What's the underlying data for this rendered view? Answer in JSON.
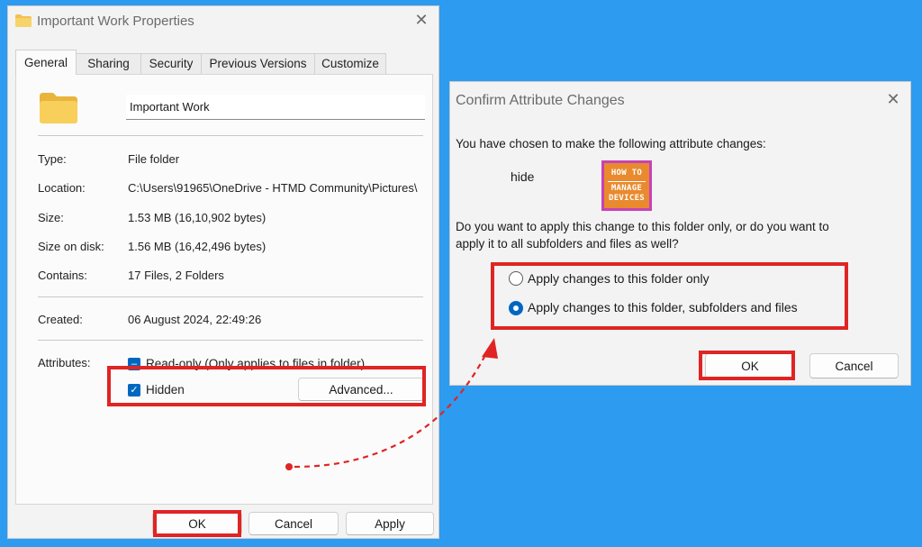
{
  "properties": {
    "title": "Important Work Properties",
    "close_glyph": "✕",
    "tabs": [
      {
        "label": "General"
      },
      {
        "label": "Sharing"
      },
      {
        "label": "Security"
      },
      {
        "label": "Previous Versions"
      },
      {
        "label": "Customize"
      }
    ],
    "name_value": "Important Work",
    "rows": {
      "type": {
        "label": "Type:",
        "value": "File folder"
      },
      "location": {
        "label": "Location:",
        "value": "C:\\Users\\91965\\OneDrive - HTMD Community\\Pictures\\"
      },
      "size": {
        "label": "Size:",
        "value": "1.53 MB (16,10,902 bytes)"
      },
      "size_on_disk": {
        "label": "Size on disk:",
        "value": "1.56 MB (16,42,496 bytes)"
      },
      "contains": {
        "label": "Contains:",
        "value": "17 Files, 2 Folders"
      },
      "created": {
        "label": "Created:",
        "value": "06 August 2024, 22:49:26"
      },
      "attributes": {
        "label": "Attributes:"
      }
    },
    "readonly_label": "Read-only (Only applies to files in folder)",
    "readonly_glyph": "–",
    "hidden_label": "Hidden",
    "hidden_glyph": "✓",
    "advanced_label": "Advanced...",
    "buttons": {
      "ok": "OK",
      "cancel": "Cancel",
      "apply": "Apply"
    }
  },
  "confirm": {
    "title": "Confirm Attribute Changes",
    "close_glyph": "✕",
    "intro": "You have chosen to make the following attribute changes:",
    "change": "hide",
    "logo": {
      "line1": "HOW TO",
      "line2": "MANAGE",
      "line3": "DEVICES"
    },
    "question_line1": "Do you want to apply this change to this folder only, or do you want to",
    "question_line2": "apply it to all subfolders and files as well?",
    "options": [
      {
        "label": "Apply changes to this folder only",
        "selected": false
      },
      {
        "label": "Apply changes to this folder, subfolders and files",
        "selected": true
      }
    ],
    "buttons": {
      "ok": "OK",
      "cancel": "Cancel"
    }
  },
  "colors": {
    "background": "#2d9bf0",
    "highlight": "#e02424",
    "accent": "#0067c0"
  }
}
